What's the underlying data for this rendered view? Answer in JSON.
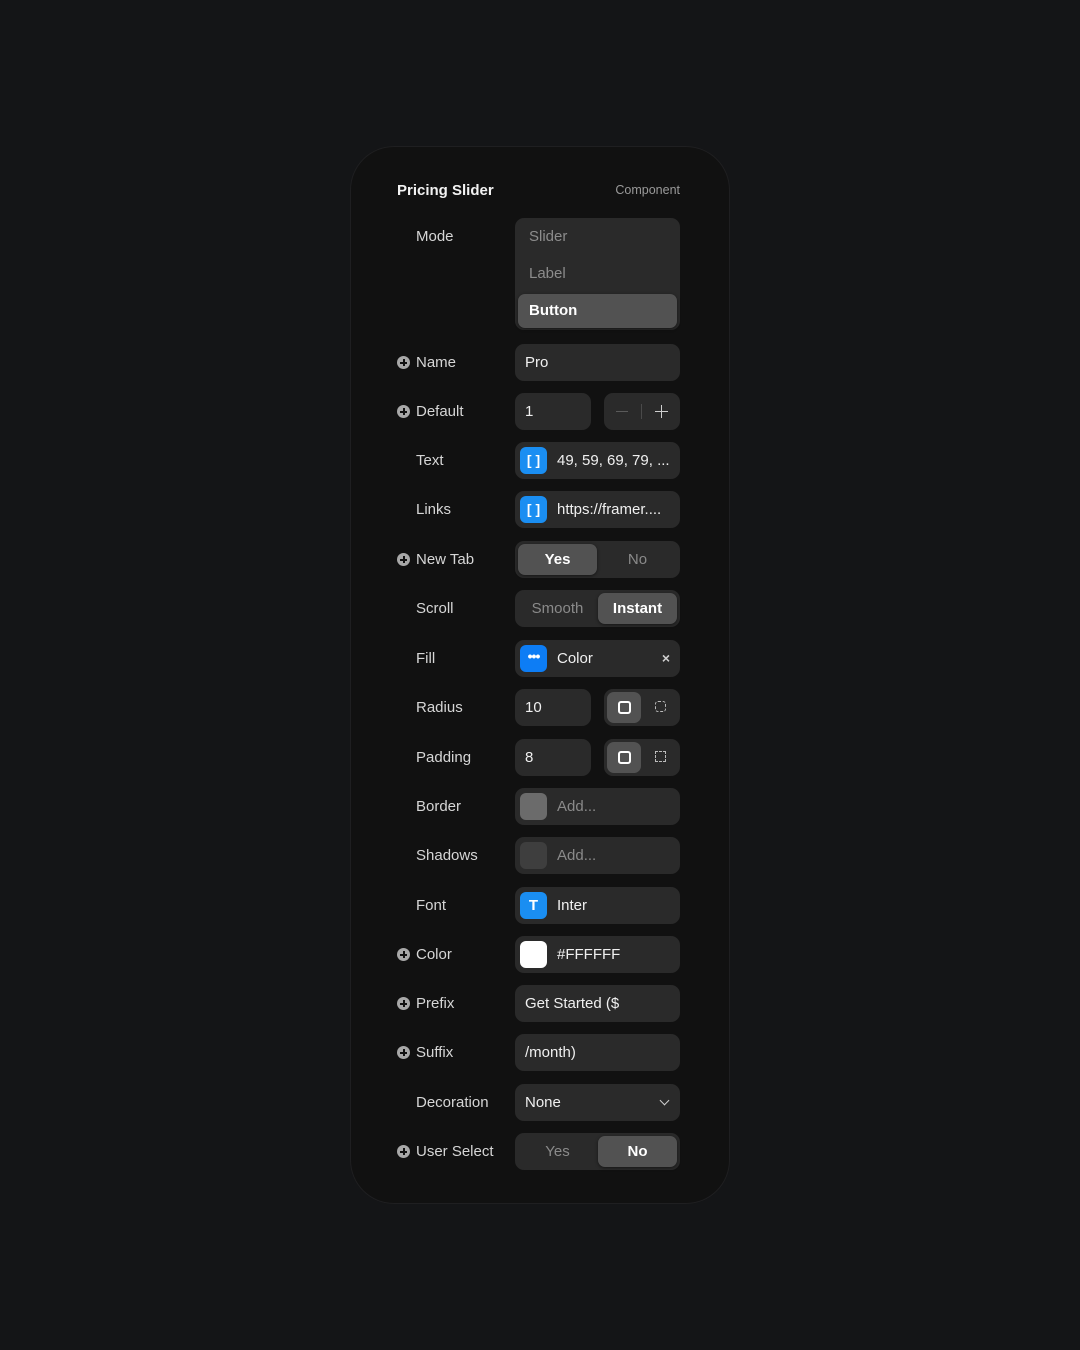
{
  "panel": {
    "title": "Pricing Slider",
    "subtitle": "Component"
  },
  "mode": {
    "label": "Mode",
    "options": [
      "Slider",
      "Label",
      "Button"
    ],
    "selected": "Button"
  },
  "name": {
    "label": "Name",
    "value": "Pro",
    "has_add_icon": true
  },
  "default": {
    "label": "Default",
    "value": "1",
    "decrement_icon": "minus-icon",
    "increment_icon": "plus-icon",
    "has_add_icon": true
  },
  "text": {
    "label": "Text",
    "icon": "array-bracket-icon",
    "icon_glyph": "[ ]",
    "value": "49, 59, 69, 79, ..."
  },
  "links": {
    "label": "Links",
    "icon": "array-bracket-icon",
    "icon_glyph": "[ ]",
    "value": "https://framer...."
  },
  "new_tab": {
    "label": "New Tab",
    "options": [
      "Yes",
      "No"
    ],
    "selected": "Yes",
    "has_add_icon": true
  },
  "scroll": {
    "label": "Scroll",
    "options": [
      "Smooth",
      "Instant"
    ],
    "selected": "Instant"
  },
  "fill": {
    "label": "Fill",
    "icon": "more-dots-icon",
    "icon_glyph": "•••",
    "value": "Color",
    "clear_glyph": "×",
    "swatch_color": "#0D7DF5"
  },
  "radius": {
    "label": "Radius",
    "value": "10",
    "modes": [
      "uniform-corners-icon",
      "individual-corners-icon"
    ],
    "selected_mode": "uniform-corners-icon"
  },
  "padding": {
    "label": "Padding",
    "value": "8",
    "modes": [
      "uniform-padding-icon",
      "individual-padding-icon"
    ],
    "selected_mode": "uniform-padding-icon"
  },
  "border": {
    "label": "Border",
    "placeholder": "Add...",
    "swatch_color": "#6B6B6B"
  },
  "shadows": {
    "label": "Shadows",
    "placeholder": "Add...",
    "swatch_color": "#3E3E3E"
  },
  "font": {
    "label": "Font",
    "icon": "text-type-icon",
    "icon_glyph": "T",
    "value": "Inter"
  },
  "color": {
    "label": "Color",
    "value": "#FFFFFF",
    "swatch_color": "#FFFFFF",
    "has_add_icon": true
  },
  "prefix": {
    "label": "Prefix",
    "value": "Get Started ($",
    "has_add_icon": true
  },
  "suffix": {
    "label": "Suffix",
    "value": "/month)",
    "has_add_icon": true
  },
  "decoration": {
    "label": "Decoration",
    "value": "None"
  },
  "user_select": {
    "label": "User Select",
    "options": [
      "Yes",
      "No"
    ],
    "selected": "No",
    "has_add_icon": true
  },
  "colors": {
    "page_bg": "#141517",
    "panel_bg": "#111111",
    "control_bg": "#2A2A2A",
    "selected_bg": "#525252",
    "accent_blue": "#1A8EF2"
  }
}
